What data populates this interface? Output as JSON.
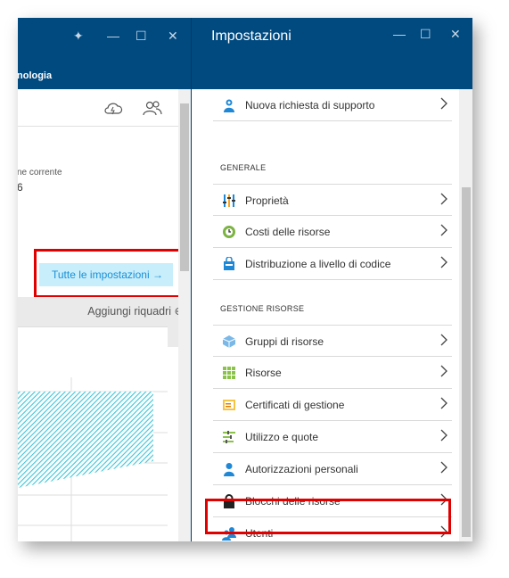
{
  "left_blade": {
    "subtitle": "nologia",
    "controls": {
      "pin": "✦",
      "minimize": "—",
      "maximize": "☐",
      "close": "✕"
    },
    "current_label": "ne corrente",
    "current_value": "6",
    "all_settings_label": "Tutte le impostazioni →",
    "add_tiles_label": "Aggiungi riquadri ⊕"
  },
  "settings_blade": {
    "title": "Impostazioni",
    "controls": {
      "minimize": "—",
      "maximize": "☐",
      "close": "✕"
    },
    "top_items": [
      {
        "label": "Nuova richiesta di supporto",
        "icon": "support-person-icon"
      }
    ],
    "sections": [
      {
        "title": "GENERALE",
        "items": [
          {
            "label": "Proprietà",
            "icon": "properties-sliders-icon"
          },
          {
            "label": "Costi delle risorse",
            "icon": "cost-clock-icon"
          },
          {
            "label": "Distribuzione a livello di codice",
            "icon": "shopping-bag-icon"
          }
        ]
      },
      {
        "title": "GESTIONE RISORSE",
        "items": [
          {
            "label": "Gruppi di risorse",
            "icon": "resource-group-cube-icon"
          },
          {
            "label": "Risorse",
            "icon": "resources-grid-icon"
          },
          {
            "label": "Certificati di gestione",
            "icon": "certificate-icon"
          },
          {
            "label": "Utilizzo e quote",
            "icon": "usage-bars-icon"
          },
          {
            "label": "Autorizzazioni personali",
            "icon": "person-icon"
          },
          {
            "label": "Blocchi delle risorse",
            "icon": "lock-icon"
          },
          {
            "label": "Utenti",
            "icon": "users-icon"
          }
        ]
      }
    ]
  },
  "colors": {
    "header": "#004a80",
    "highlight": "#e00000",
    "accent": "#1a8fd6",
    "hatch": "#3cc4d8"
  }
}
